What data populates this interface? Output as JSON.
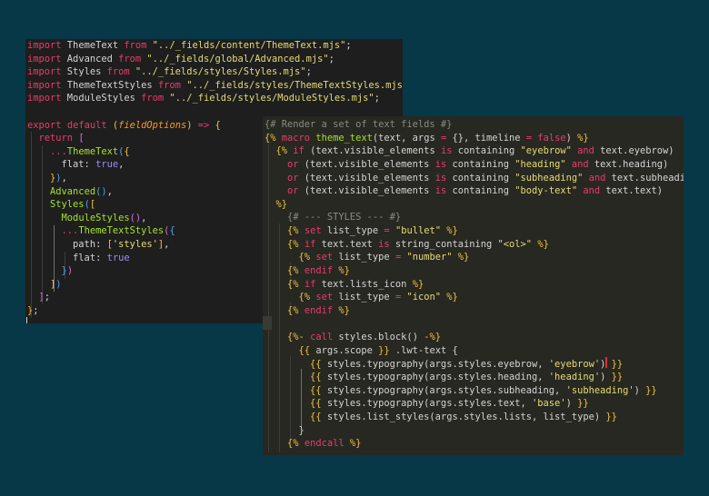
{
  "colors": {
    "background": "#073848",
    "editor_js": "#1e1e1e",
    "editor_tpl": "#272822",
    "keyword": "#e83c6b",
    "string": "#e6db74",
    "plain": "#d4d4d4",
    "func": "#a6e22e",
    "bool": "#9b8df7",
    "param": "#fd971f",
    "comment": "#8a8a82",
    "bracket": "#f0c23a",
    "bracket2": "#d670d6",
    "bracket3": "#4fa2e8",
    "property": "#f8f8f2"
  },
  "js_editor": {
    "lines": [
      [
        [
          "kw",
          "import"
        ],
        [
          "p",
          " ThemeText "
        ],
        [
          "kw",
          "from"
        ],
        [
          "p",
          " "
        ],
        [
          "str",
          "\"../_fields/content/ThemeText.mjs\""
        ],
        [
          "p",
          ";"
        ]
      ],
      [
        [
          "kw",
          "import"
        ],
        [
          "p",
          " Advanced "
        ],
        [
          "kw",
          "from"
        ],
        [
          "p",
          " "
        ],
        [
          "str",
          "\"../_fields/global/Advanced.mjs\""
        ],
        [
          "p",
          ";"
        ]
      ],
      [
        [
          "kw",
          "import"
        ],
        [
          "p",
          " Styles "
        ],
        [
          "kw",
          "from"
        ],
        [
          "p",
          " "
        ],
        [
          "str",
          "\"../_fields/styles/Styles.mjs\""
        ],
        [
          "p",
          ";"
        ]
      ],
      [
        [
          "kw",
          "import"
        ],
        [
          "p",
          " ThemeTextStyles "
        ],
        [
          "kw",
          "from"
        ],
        [
          "p",
          " "
        ],
        [
          "str",
          "\"../_fields/styles/ThemeTextStyles.mjs\""
        ],
        [
          "p",
          ";"
        ]
      ],
      [
        [
          "kw",
          "import"
        ],
        [
          "p",
          " ModuleStyles "
        ],
        [
          "kw",
          "from"
        ],
        [
          "p",
          " "
        ],
        [
          "str",
          "\"../_fields/styles/ModuleStyles.mjs\""
        ],
        [
          "p",
          ";"
        ]
      ],
      [],
      [
        [
          "kw",
          "export"
        ],
        [
          "p",
          " "
        ],
        [
          "kw",
          "default"
        ],
        [
          "p",
          " "
        ],
        [
          "br",
          "("
        ],
        [
          "param",
          "fieldOptions"
        ],
        [
          "br",
          ")"
        ],
        [
          "p",
          " "
        ],
        [
          "kw",
          "=>"
        ],
        [
          "p",
          " "
        ],
        [
          "br",
          "{"
        ]
      ],
      [
        [
          "p",
          "  "
        ],
        [
          "kw",
          "return"
        ],
        [
          "p",
          " "
        ],
        [
          "br2",
          "["
        ]
      ],
      [
        [
          "p",
          "    "
        ],
        [
          "kw",
          "..."
        ],
        [
          "fn",
          "ThemeText"
        ],
        [
          "br3",
          "("
        ],
        [
          "br",
          "{"
        ]
      ],
      [
        [
          "p",
          "      flat: "
        ],
        [
          "bool",
          "true"
        ],
        [
          "p",
          ","
        ]
      ],
      [
        [
          "p",
          "    "
        ],
        [
          "br",
          "}"
        ],
        [
          "br3",
          ")"
        ],
        [
          "p",
          ","
        ]
      ],
      [
        [
          "p",
          "    "
        ],
        [
          "fn",
          "Advanced"
        ],
        [
          "br3",
          "()"
        ],
        [
          "p",
          ","
        ]
      ],
      [
        [
          "p",
          "    "
        ],
        [
          "fn",
          "Styles"
        ],
        [
          "br3",
          "("
        ],
        [
          "br",
          "["
        ]
      ],
      [
        [
          "p",
          "      "
        ],
        [
          "fn",
          "ModuleStyles"
        ],
        [
          "br2",
          "()"
        ],
        [
          "p",
          ","
        ]
      ],
      [
        [
          "p",
          "      "
        ],
        [
          "kw",
          "..."
        ],
        [
          "fn",
          "ThemeTextStyles"
        ],
        [
          "br2",
          "("
        ],
        [
          "br3",
          "{"
        ]
      ],
      [
        [
          "p",
          "        path: "
        ],
        [
          "br",
          "["
        ],
        [
          "str",
          "'styles'"
        ],
        [
          "br",
          "]"
        ],
        [
          "p",
          ","
        ]
      ],
      [
        [
          "p",
          "        flat: "
        ],
        [
          "bool",
          "true"
        ]
      ],
      [
        [
          "p",
          "      "
        ],
        [
          "br3",
          "}"
        ],
        [
          "br2",
          ")"
        ]
      ],
      [
        [
          "p",
          "    "
        ],
        [
          "br",
          "]"
        ],
        [
          "br3",
          ")"
        ]
      ],
      [
        [
          "p",
          "  "
        ],
        [
          "br2",
          "]"
        ],
        [
          "p",
          ";"
        ]
      ],
      [
        [
          "br",
          "}"
        ],
        [
          "p",
          ";"
        ]
      ]
    ]
  },
  "tpl_editor": {
    "lines": [
      [
        [
          "cm",
          "{# Render a set of text fields #}"
        ]
      ],
      [
        [
          "br",
          "{%"
        ],
        [
          "p",
          " "
        ],
        [
          "kw",
          "macro"
        ],
        [
          "p",
          " "
        ],
        [
          "fn",
          "theme_text"
        ],
        [
          "p",
          "(text, args "
        ],
        [
          "kw",
          "="
        ],
        [
          "p",
          " {}, timeline "
        ],
        [
          "kw",
          "="
        ],
        [
          "p",
          " "
        ],
        [
          "kw",
          "false"
        ],
        [
          "p",
          ") "
        ],
        [
          "br",
          "%}"
        ]
      ],
      [
        [
          "p",
          "  "
        ],
        [
          "br",
          "{%"
        ],
        [
          "p",
          " "
        ],
        [
          "kw",
          "if"
        ],
        [
          "p",
          " (text.visible_elements "
        ],
        [
          "kw",
          "is"
        ],
        [
          "p",
          " containing "
        ],
        [
          "str",
          "\"eyebrow\""
        ],
        [
          "p",
          " "
        ],
        [
          "kw",
          "and"
        ],
        [
          "p",
          " text.eyebrow)"
        ]
      ],
      [
        [
          "p",
          "    "
        ],
        [
          "kw",
          "or"
        ],
        [
          "p",
          " (text.visible_elements "
        ],
        [
          "kw",
          "is"
        ],
        [
          "p",
          " containing "
        ],
        [
          "str",
          "\"heading\""
        ],
        [
          "p",
          " "
        ],
        [
          "kw",
          "and"
        ],
        [
          "p",
          " text.heading)"
        ]
      ],
      [
        [
          "p",
          "    "
        ],
        [
          "kw",
          "or"
        ],
        [
          "p",
          " (text.visible_elements "
        ],
        [
          "kw",
          "is"
        ],
        [
          "p",
          " containing "
        ],
        [
          "str",
          "\"subheading\""
        ],
        [
          "p",
          " "
        ],
        [
          "kw",
          "and"
        ],
        [
          "p",
          " text.subheading)"
        ]
      ],
      [
        [
          "p",
          "    "
        ],
        [
          "kw",
          "or"
        ],
        [
          "p",
          " (text.visible_elements "
        ],
        [
          "kw",
          "is"
        ],
        [
          "p",
          " containing "
        ],
        [
          "str",
          "\"body-text\""
        ],
        [
          "p",
          " "
        ],
        [
          "kw",
          "and"
        ],
        [
          "p",
          " text.text)"
        ]
      ],
      [
        [
          "p",
          "  "
        ],
        [
          "br",
          "%}"
        ]
      ],
      [
        [
          "p",
          "    "
        ],
        [
          "cm",
          "{# --- STYLES --- #}"
        ]
      ],
      [
        [
          "p",
          "    "
        ],
        [
          "br",
          "{%"
        ],
        [
          "p",
          " "
        ],
        [
          "kw",
          "set"
        ],
        [
          "p",
          " list_type "
        ],
        [
          "kw",
          "="
        ],
        [
          "p",
          " "
        ],
        [
          "str",
          "\"bullet\""
        ],
        [
          "p",
          " "
        ],
        [
          "br",
          "%}"
        ]
      ],
      [
        [
          "p",
          "    "
        ],
        [
          "br",
          "{%"
        ],
        [
          "p",
          " "
        ],
        [
          "kw",
          "if"
        ],
        [
          "p",
          " text.text "
        ],
        [
          "kw",
          "is"
        ],
        [
          "p",
          " string_containing "
        ],
        [
          "str",
          "\"<ol>\""
        ],
        [
          "p",
          " "
        ],
        [
          "br",
          "%}"
        ]
      ],
      [
        [
          "p",
          "      "
        ],
        [
          "br",
          "{%"
        ],
        [
          "p",
          " "
        ],
        [
          "kw",
          "set"
        ],
        [
          "p",
          " list_type "
        ],
        [
          "kw",
          "="
        ],
        [
          "p",
          " "
        ],
        [
          "str",
          "\"number\""
        ],
        [
          "p",
          " "
        ],
        [
          "br",
          "%}"
        ]
      ],
      [
        [
          "p",
          "    "
        ],
        [
          "br",
          "{%"
        ],
        [
          "p",
          " "
        ],
        [
          "kw",
          "endif"
        ],
        [
          "p",
          " "
        ],
        [
          "br",
          "%}"
        ]
      ],
      [
        [
          "p",
          "    "
        ],
        [
          "br",
          "{%"
        ],
        [
          "p",
          " "
        ],
        [
          "kw",
          "if"
        ],
        [
          "p",
          " text.lists_icon "
        ],
        [
          "br",
          "%}"
        ]
      ],
      [
        [
          "p",
          "      "
        ],
        [
          "br",
          "{%"
        ],
        [
          "p",
          " "
        ],
        [
          "kw",
          "set"
        ],
        [
          "p",
          " list_type "
        ],
        [
          "kw",
          "="
        ],
        [
          "p",
          " "
        ],
        [
          "str",
          "\"icon\""
        ],
        [
          "p",
          " "
        ],
        [
          "br",
          "%}"
        ]
      ],
      [
        [
          "p",
          "    "
        ],
        [
          "br",
          "{%"
        ],
        [
          "p",
          " "
        ],
        [
          "kw",
          "endif"
        ],
        [
          "p",
          " "
        ],
        [
          "br",
          "%}"
        ]
      ],
      [],
      [
        [
          "p",
          "    "
        ],
        [
          "br",
          "{%-"
        ],
        [
          "p",
          " "
        ],
        [
          "kw",
          "call"
        ],
        [
          "p",
          " styles.block() "
        ],
        [
          "br",
          "-%}"
        ]
      ],
      [
        [
          "p",
          "      "
        ],
        [
          "br",
          "{{"
        ],
        [
          "p",
          " args.scope "
        ],
        [
          "br",
          "}}"
        ],
        [
          "p",
          " .lwt-text {"
        ]
      ],
      [
        [
          "p",
          "        "
        ],
        [
          "br",
          "{{"
        ],
        [
          "p",
          " styles.typography(args.styles.eyebrow, "
        ],
        [
          "str",
          "'eyebrow'"
        ],
        [
          "p",
          ") "
        ],
        [
          "br",
          "}}"
        ]
      ],
      [
        [
          "p",
          "        "
        ],
        [
          "br",
          "{{"
        ],
        [
          "p",
          " styles.typography(args.styles.heading, "
        ],
        [
          "str",
          "'heading'"
        ],
        [
          "p",
          ") "
        ],
        [
          "br",
          "}}"
        ]
      ],
      [
        [
          "p",
          "        "
        ],
        [
          "br",
          "{{"
        ],
        [
          "p",
          " styles.typography(args.styles.subheading, "
        ],
        [
          "str",
          "'subheading'"
        ],
        [
          "p",
          ") "
        ],
        [
          "br",
          "}}"
        ]
      ],
      [
        [
          "p",
          "        "
        ],
        [
          "br",
          "{{"
        ],
        [
          "p",
          " styles.typography(args.styles.text, "
        ],
        [
          "str",
          "'base'"
        ],
        [
          "p",
          ") "
        ],
        [
          "br",
          "}}"
        ]
      ],
      [
        [
          "p",
          "        "
        ],
        [
          "br",
          "{{"
        ],
        [
          "p",
          " styles.list_styles(args.styles.lists, list_type) "
        ],
        [
          "br",
          "}}"
        ]
      ],
      [
        [
          "p",
          "      }"
        ]
      ],
      [
        [
          "p",
          "    "
        ],
        [
          "br",
          "{%"
        ],
        [
          "p",
          " "
        ],
        [
          "kw",
          "endcall"
        ],
        [
          "p",
          " "
        ],
        [
          "br",
          "%}"
        ]
      ]
    ]
  }
}
